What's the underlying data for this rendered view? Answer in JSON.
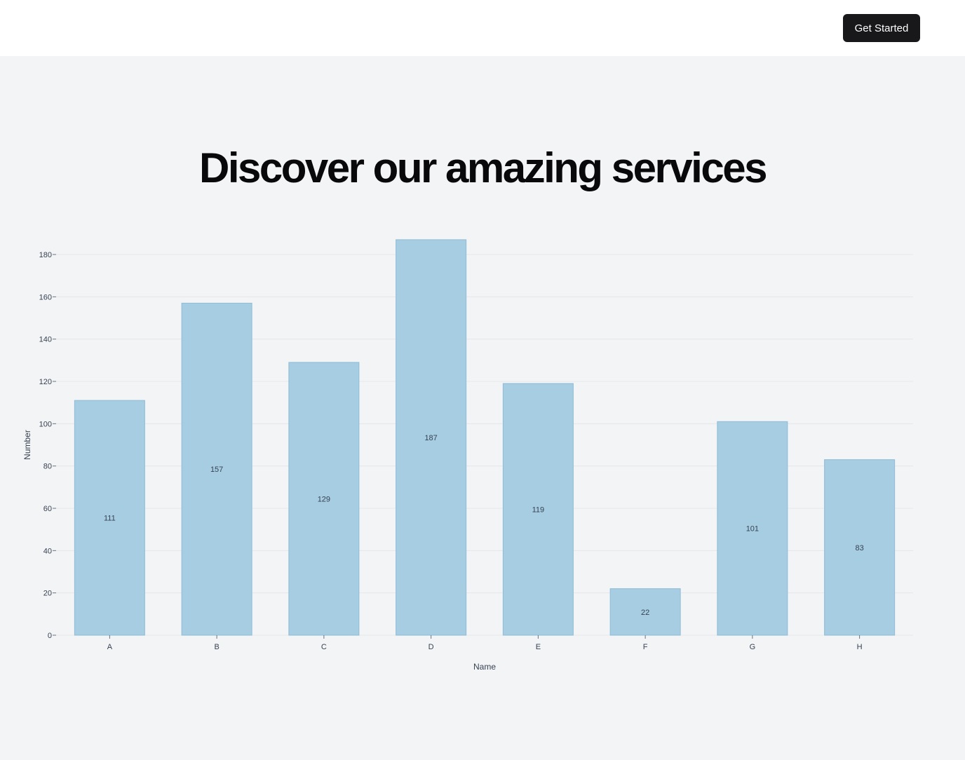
{
  "header": {
    "cta_label": "Get Started"
  },
  "hero": {
    "title": "Discover our amazing services"
  },
  "colors": {
    "bar_fill": "#a6cde2",
    "bar_stroke": "#8fbcd6",
    "grid": "#e5e7eb",
    "cta_bg": "#18181b"
  },
  "chart_data": {
    "type": "bar",
    "categories": [
      "A",
      "B",
      "C",
      "D",
      "E",
      "F",
      "G",
      "H"
    ],
    "values": [
      111,
      157,
      129,
      187,
      119,
      22,
      101,
      83
    ],
    "xlabel": "Name",
    "ylabel": "Number",
    "ylim": [
      0,
      180
    ],
    "yticks": [
      0,
      20,
      40,
      60,
      80,
      100,
      120,
      140,
      160,
      180
    ],
    "grid": true,
    "data_labels": true
  }
}
